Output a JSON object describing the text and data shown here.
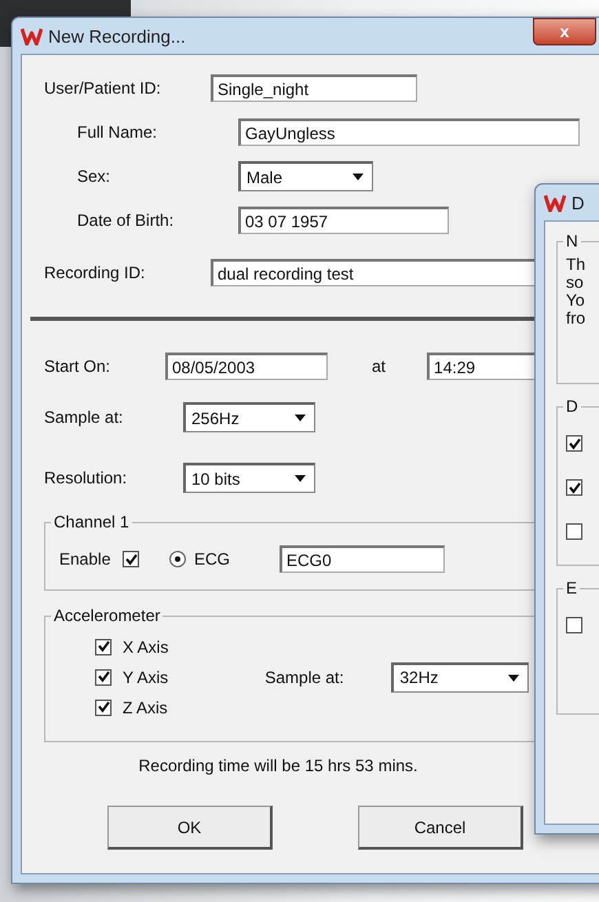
{
  "window": {
    "title": "New Recording...",
    "close": "x"
  },
  "user_id": {
    "label": "User/Patient ID:",
    "value": "Single_night"
  },
  "details": [
    {
      "label": "Full Name:",
      "value": "GayUngless",
      "kind": "text"
    },
    {
      "label": "Sex:",
      "value": "Male",
      "kind": "select"
    },
    {
      "label": "Date of Birth:",
      "value": "03 07 1957",
      "kind": "text"
    }
  ],
  "recording_id": {
    "label": "Recording ID:",
    "value": "dual recording test"
  },
  "start": {
    "label": "Start On:",
    "date": "08/05/2003",
    "at_label": "at",
    "time": "14:29"
  },
  "settings": [
    {
      "label": "Sample at:",
      "value": "256Hz"
    },
    {
      "label": "Resolution:",
      "value": "10 bits"
    }
  ],
  "channel": {
    "title": "Channel 1",
    "enable_label": "Enable",
    "enabled": true,
    "radio_label": "ECG",
    "radio_selected": true,
    "name": "ECG0"
  },
  "accelerometer": {
    "title": "Accelerometer",
    "axes": [
      {
        "label": "X Axis",
        "checked": true
      },
      {
        "label": "Y Axis",
        "checked": true
      },
      {
        "label": "Z Axis",
        "checked": true
      }
    ],
    "sample_label": "Sample at:",
    "sample_value": "32Hz"
  },
  "summary": "Recording time will be 15 hrs 53 mins.",
  "buttons": [
    "OK",
    "Cancel"
  ],
  "second_window": {
    "title": "D",
    "groups": [
      {
        "title": "N",
        "lines": [
          "Th",
          "so",
          "Yo",
          "fro"
        ]
      },
      {
        "title": "D",
        "checkboxes": [
          {
            "checked": true
          },
          {
            "checked": true
          },
          {
            "checked": false
          }
        ]
      },
      {
        "title": "E",
        "checkboxes": [
          {
            "checked": false
          }
        ]
      }
    ]
  }
}
